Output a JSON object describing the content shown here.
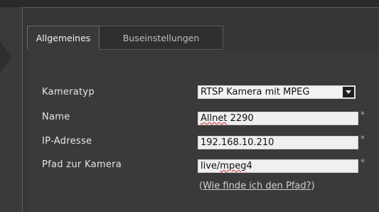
{
  "tabs": [
    {
      "label": "Allgemeines",
      "active": true
    },
    {
      "label": "Buseinstellungen",
      "active": false
    }
  ],
  "form": {
    "camera_type": {
      "label": "Kameratyp",
      "value": "RTSP Kamera mit MPEG"
    },
    "name": {
      "label": "Name",
      "value_prefix": "",
      "value_spell": "Allnet",
      "value_suffix": " 2290",
      "required": "*"
    },
    "ip": {
      "label": "IP-Adresse",
      "value": "192.168.10.210",
      "required": "*"
    },
    "path": {
      "label": "Pfad zur Kamera",
      "value_prefix": "live/",
      "value_spell": "mpeg",
      "value_suffix": "4",
      "required": "*"
    }
  },
  "help_link": {
    "open": "(",
    "text": "Wie finde ich den Pfad?",
    "close": ")"
  },
  "icons": {
    "dropdown": "chevron-down-icon"
  },
  "colors": {
    "background": "#3a3a3a",
    "field": "#efefef",
    "text": "#e6e6e6"
  }
}
